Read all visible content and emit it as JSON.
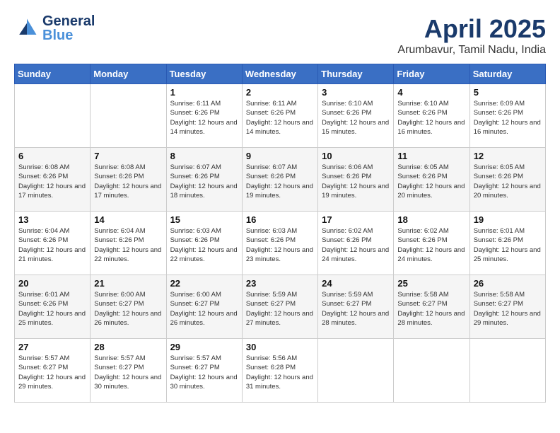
{
  "header": {
    "logo_general": "General",
    "logo_blue": "Blue",
    "title": "April 2025",
    "subtitle": "Arumbavur, Tamil Nadu, India"
  },
  "calendar": {
    "days_of_week": [
      "Sunday",
      "Monday",
      "Tuesday",
      "Wednesday",
      "Thursday",
      "Friday",
      "Saturday"
    ],
    "weeks": [
      [
        {
          "day": "",
          "info": ""
        },
        {
          "day": "",
          "info": ""
        },
        {
          "day": "1",
          "info": "Sunrise: 6:11 AM\nSunset: 6:26 PM\nDaylight: 12 hours and 14 minutes."
        },
        {
          "day": "2",
          "info": "Sunrise: 6:11 AM\nSunset: 6:26 PM\nDaylight: 12 hours and 14 minutes."
        },
        {
          "day": "3",
          "info": "Sunrise: 6:10 AM\nSunset: 6:26 PM\nDaylight: 12 hours and 15 minutes."
        },
        {
          "day": "4",
          "info": "Sunrise: 6:10 AM\nSunset: 6:26 PM\nDaylight: 12 hours and 16 minutes."
        },
        {
          "day": "5",
          "info": "Sunrise: 6:09 AM\nSunset: 6:26 PM\nDaylight: 12 hours and 16 minutes."
        }
      ],
      [
        {
          "day": "6",
          "info": "Sunrise: 6:08 AM\nSunset: 6:26 PM\nDaylight: 12 hours and 17 minutes."
        },
        {
          "day": "7",
          "info": "Sunrise: 6:08 AM\nSunset: 6:26 PM\nDaylight: 12 hours and 17 minutes."
        },
        {
          "day": "8",
          "info": "Sunrise: 6:07 AM\nSunset: 6:26 PM\nDaylight: 12 hours and 18 minutes."
        },
        {
          "day": "9",
          "info": "Sunrise: 6:07 AM\nSunset: 6:26 PM\nDaylight: 12 hours and 19 minutes."
        },
        {
          "day": "10",
          "info": "Sunrise: 6:06 AM\nSunset: 6:26 PM\nDaylight: 12 hours and 19 minutes."
        },
        {
          "day": "11",
          "info": "Sunrise: 6:05 AM\nSunset: 6:26 PM\nDaylight: 12 hours and 20 minutes."
        },
        {
          "day": "12",
          "info": "Sunrise: 6:05 AM\nSunset: 6:26 PM\nDaylight: 12 hours and 20 minutes."
        }
      ],
      [
        {
          "day": "13",
          "info": "Sunrise: 6:04 AM\nSunset: 6:26 PM\nDaylight: 12 hours and 21 minutes."
        },
        {
          "day": "14",
          "info": "Sunrise: 6:04 AM\nSunset: 6:26 PM\nDaylight: 12 hours and 22 minutes."
        },
        {
          "day": "15",
          "info": "Sunrise: 6:03 AM\nSunset: 6:26 PM\nDaylight: 12 hours and 22 minutes."
        },
        {
          "day": "16",
          "info": "Sunrise: 6:03 AM\nSunset: 6:26 PM\nDaylight: 12 hours and 23 minutes."
        },
        {
          "day": "17",
          "info": "Sunrise: 6:02 AM\nSunset: 6:26 PM\nDaylight: 12 hours and 24 minutes."
        },
        {
          "day": "18",
          "info": "Sunrise: 6:02 AM\nSunset: 6:26 PM\nDaylight: 12 hours and 24 minutes."
        },
        {
          "day": "19",
          "info": "Sunrise: 6:01 AM\nSunset: 6:26 PM\nDaylight: 12 hours and 25 minutes."
        }
      ],
      [
        {
          "day": "20",
          "info": "Sunrise: 6:01 AM\nSunset: 6:26 PM\nDaylight: 12 hours and 25 minutes."
        },
        {
          "day": "21",
          "info": "Sunrise: 6:00 AM\nSunset: 6:27 PM\nDaylight: 12 hours and 26 minutes."
        },
        {
          "day": "22",
          "info": "Sunrise: 6:00 AM\nSunset: 6:27 PM\nDaylight: 12 hours and 26 minutes."
        },
        {
          "day": "23",
          "info": "Sunrise: 5:59 AM\nSunset: 6:27 PM\nDaylight: 12 hours and 27 minutes."
        },
        {
          "day": "24",
          "info": "Sunrise: 5:59 AM\nSunset: 6:27 PM\nDaylight: 12 hours and 28 minutes."
        },
        {
          "day": "25",
          "info": "Sunrise: 5:58 AM\nSunset: 6:27 PM\nDaylight: 12 hours and 28 minutes."
        },
        {
          "day": "26",
          "info": "Sunrise: 5:58 AM\nSunset: 6:27 PM\nDaylight: 12 hours and 29 minutes."
        }
      ],
      [
        {
          "day": "27",
          "info": "Sunrise: 5:57 AM\nSunset: 6:27 PM\nDaylight: 12 hours and 29 minutes."
        },
        {
          "day": "28",
          "info": "Sunrise: 5:57 AM\nSunset: 6:27 PM\nDaylight: 12 hours and 30 minutes."
        },
        {
          "day": "29",
          "info": "Sunrise: 5:57 AM\nSunset: 6:27 PM\nDaylight: 12 hours and 30 minutes."
        },
        {
          "day": "30",
          "info": "Sunrise: 5:56 AM\nSunset: 6:28 PM\nDaylight: 12 hours and 31 minutes."
        },
        {
          "day": "",
          "info": ""
        },
        {
          "day": "",
          "info": ""
        },
        {
          "day": "",
          "info": ""
        }
      ]
    ]
  }
}
